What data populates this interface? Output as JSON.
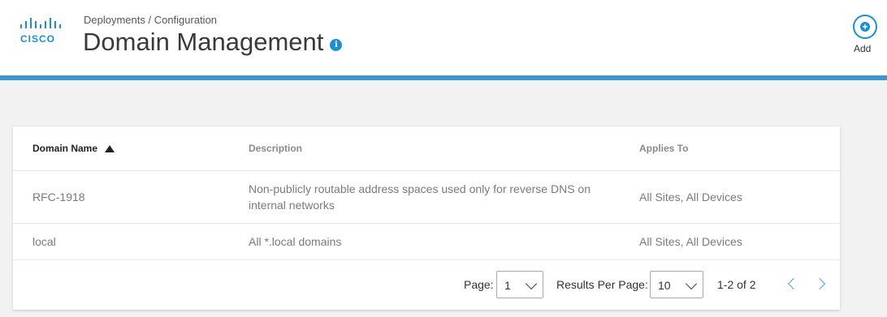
{
  "header": {
    "logo_text": "CISCO",
    "breadcrumb": "Deployments / Configuration",
    "title": "Domain Management",
    "info_icon": "info-icon",
    "add_label": "Add",
    "accent_color": "#3e95d6"
  },
  "table": {
    "columns": [
      {
        "label": "Domain Name",
        "sorted": "ascending"
      },
      {
        "label": "Description"
      },
      {
        "label": "Applies To"
      }
    ],
    "rows": [
      {
        "name": "RFC-1918",
        "description": "Non-publicly routable address spaces used only for reverse DNS on internal networks",
        "applies_to": "All Sites, All Devices"
      },
      {
        "name": "local",
        "description": "All *.local domains",
        "applies_to": "All Sites, All Devices"
      }
    ]
  },
  "pagination": {
    "page_label": "Page:",
    "page_value": "1",
    "results_label": "Results Per Page:",
    "results_value": "10",
    "range": "1-2 of 2"
  }
}
